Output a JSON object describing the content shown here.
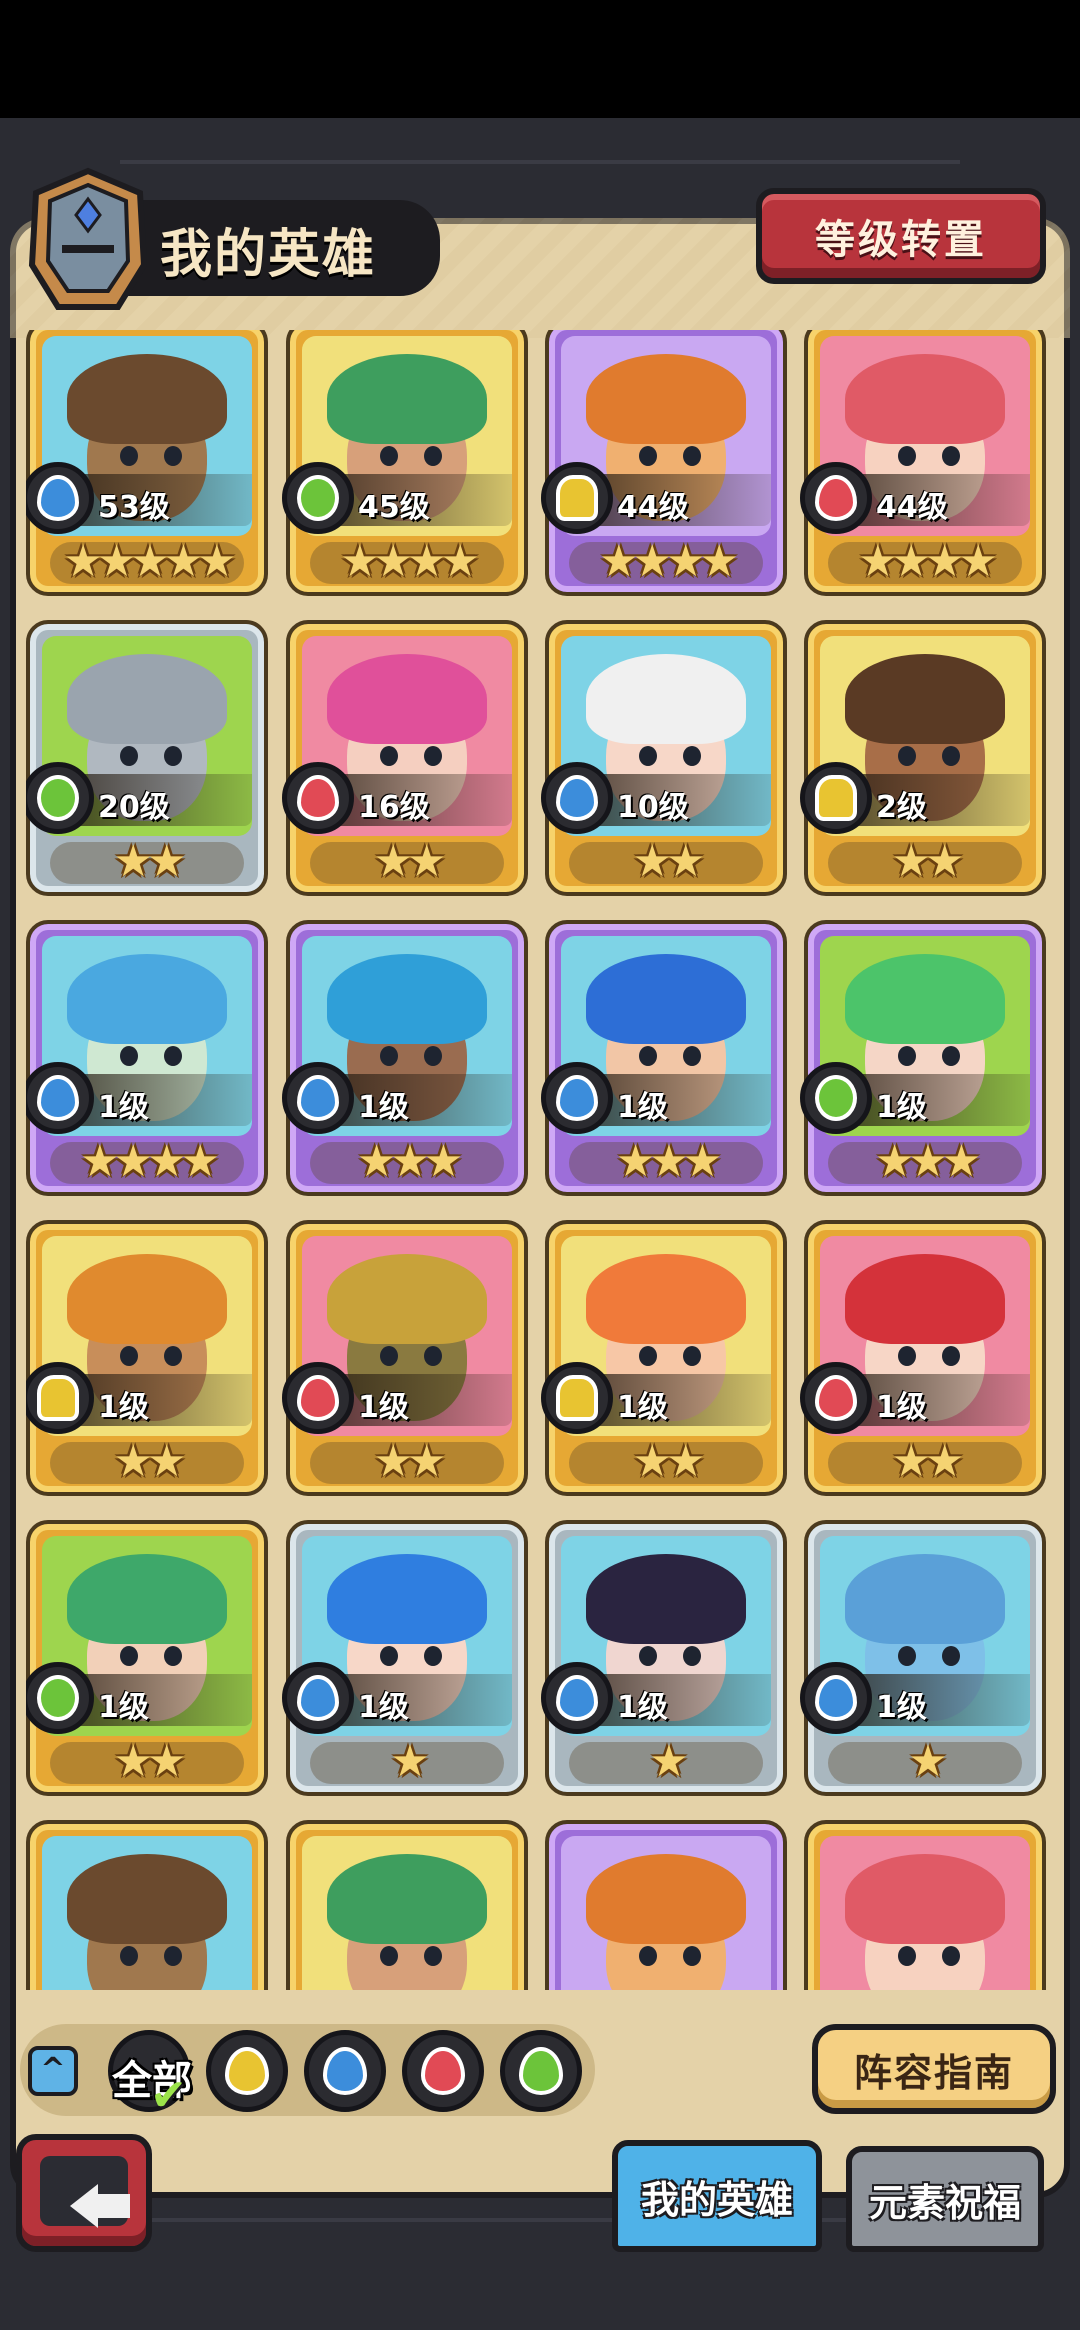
{
  "header": {
    "title": "我的英雄",
    "level_transfer_button": "等级转置"
  },
  "heroes": [
    {
      "level": "53级",
      "stars": "★★★★★",
      "element": "water-icon"
    },
    {
      "level": "45级",
      "stars": "★★★★",
      "element": "wood-icon"
    },
    {
      "level": "44级",
      "stars": "★★★★",
      "element": "earth-icon"
    },
    {
      "level": "44级",
      "stars": "★★★★",
      "element": "fire-icon"
    },
    {
      "level": "20级",
      "stars": "★★",
      "element": "wood-icon"
    },
    {
      "level": "16级",
      "stars": "★★",
      "element": "fire-icon"
    },
    {
      "level": "10级",
      "stars": "★★",
      "element": "water-icon"
    },
    {
      "level": "2级",
      "stars": "★★",
      "element": "earth-icon"
    },
    {
      "level": "1级",
      "stars": "★★★★",
      "element": "water-icon"
    },
    {
      "level": "1级",
      "stars": "★★★",
      "element": "water-icon"
    },
    {
      "level": "1级",
      "stars": "★★★",
      "element": "water-icon"
    },
    {
      "level": "1级",
      "stars": "★★★",
      "element": "wood-icon"
    },
    {
      "level": "1级",
      "stars": "★★",
      "element": "earth-icon"
    },
    {
      "level": "1级",
      "stars": "★★",
      "element": "fire-icon"
    },
    {
      "level": "1级",
      "stars": "★★",
      "element": "earth-icon"
    },
    {
      "level": "1级",
      "stars": "★★",
      "element": "fire-icon"
    },
    {
      "level": "1级",
      "stars": "★★",
      "element": "wood-icon"
    },
    {
      "level": "1级",
      "stars": "★",
      "element": "water-icon"
    },
    {
      "level": "1级",
      "stars": "★",
      "element": "water-icon"
    },
    {
      "level": "1级",
      "stars": "★",
      "element": "water-icon"
    }
  ],
  "filters": {
    "all_label": "全部",
    "items": [
      "earth-icon",
      "water-icon",
      "fire-icon",
      "wood-icon"
    ]
  },
  "lineup_guide_button": "阵容指南",
  "tabs": {
    "my_heroes": "我的英雄",
    "element_blessing": "元素祝福"
  },
  "colors": {
    "panel": "#e4d2a8",
    "frame": "#2b2c33",
    "water": "#3c8ddb",
    "fire": "#e14a55",
    "wood": "#6cc43a",
    "earth": "#e8c431",
    "active_tab": "#4fb2e8"
  }
}
